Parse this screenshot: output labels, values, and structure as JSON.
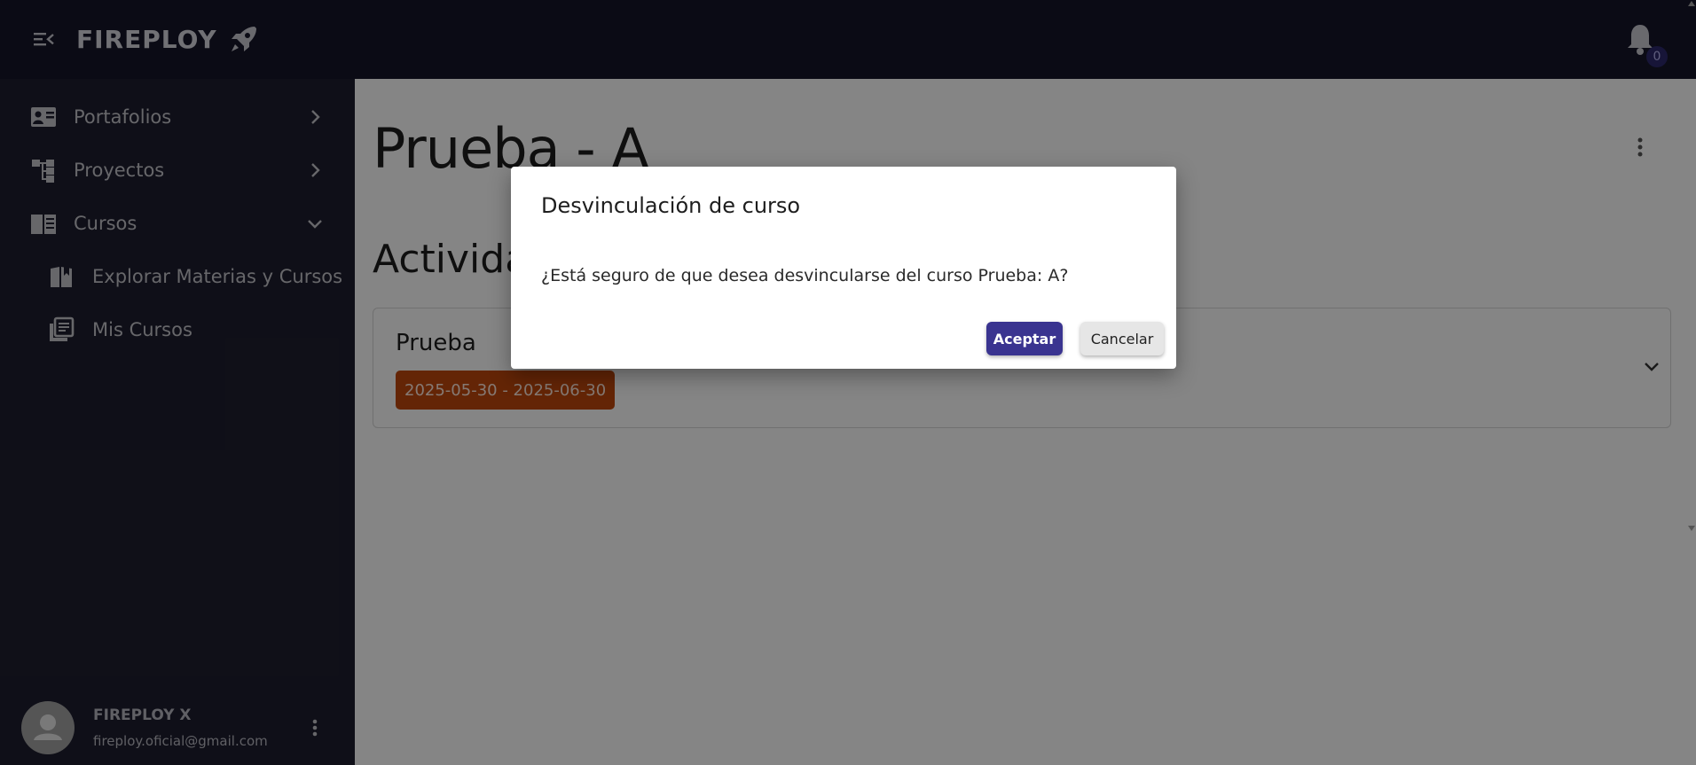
{
  "app": {
    "brand": "FIREPLOY",
    "brand_icon": "rocket-icon",
    "notifications_count": "0"
  },
  "sidebar": {
    "items": [
      {
        "label": "Portafolios",
        "icon": "portfolio-card-icon",
        "chevron": "chevron-right"
      },
      {
        "label": "Proyectos",
        "icon": "project-tree-icon",
        "chevron": "chevron-right"
      },
      {
        "label": "Cursos",
        "icon": "open-book-icon",
        "chevron": "chevron-down"
      }
    ],
    "subitems": [
      {
        "label": "Explorar Materias y Cursos",
        "icon": "library-book-icon"
      },
      {
        "label": "Mis Cursos",
        "icon": "book-stack-icon"
      }
    ],
    "user": {
      "name": "FIREPLOY X",
      "email": "fireploy.oficial@gmail.com"
    }
  },
  "main": {
    "title": "Prueba - A",
    "section_title": "Actividades",
    "activity": {
      "name": "Prueba",
      "date_range": "2025-05-30 - 2025-06-30"
    }
  },
  "dialog": {
    "title": "Desvinculación de curso",
    "message": "¿Está seguro de que desea desvincularse del curso Prueba: A?",
    "accept_label": "Aceptar",
    "cancel_label": "Cancelar"
  },
  "colors": {
    "topbar": "#16162a",
    "sidebar": "#1e1e2e",
    "accent": "#3a3490",
    "date_badge": "#c0470c"
  }
}
